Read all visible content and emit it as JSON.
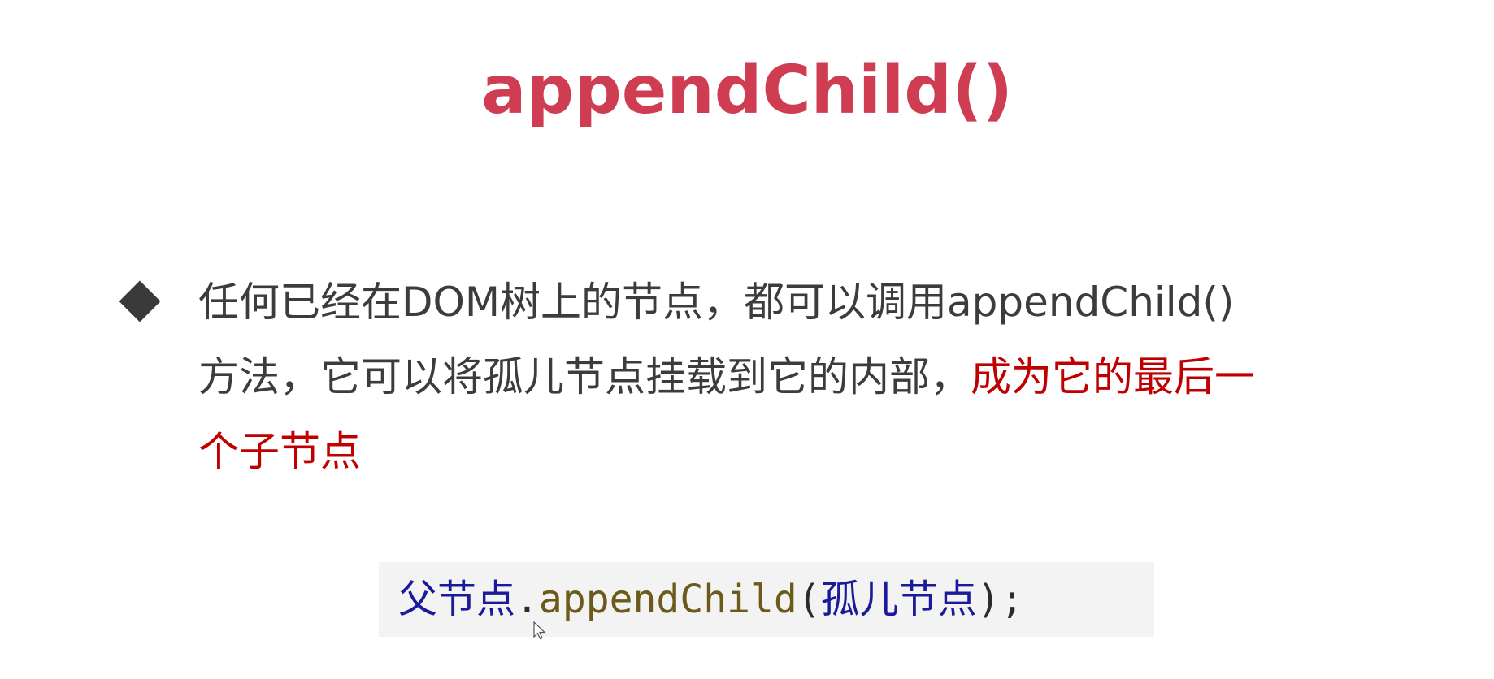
{
  "slide": {
    "title": "appendChild()",
    "bullet": {
      "line1": "任何已经在DOM树上的节点，都可以调用appendChild()",
      "line2_normal": "方法，它可以将孤儿节点挂载到它的内部，",
      "line2_highlight": "成为它的最后一",
      "line3_highlight": "个子节点"
    },
    "code": {
      "parent": "父节点",
      "dot": ".",
      "method": "appendChild",
      "open_paren": "(",
      "argument": "孤儿节点",
      "close": ");"
    },
    "colors": {
      "title": "#cf3d52",
      "highlight": "#c00000",
      "body_text": "#3c3c3c",
      "code_background": "#f3f3f3"
    },
    "icons": {
      "bullet": "diamond-bullet-icon",
      "cursor": "mouse-pointer-icon"
    }
  }
}
